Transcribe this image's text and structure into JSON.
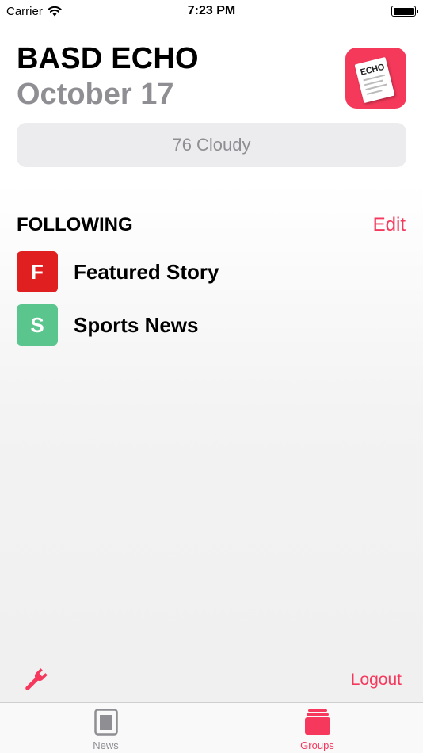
{
  "status_bar": {
    "carrier": "Carrier",
    "time": "7:23 PM"
  },
  "header": {
    "title": "BASD ECHO",
    "date": "October 17",
    "logo_text": "ECHO"
  },
  "weather": {
    "text": "76 Cloudy"
  },
  "following": {
    "heading": "FOLLOWING",
    "edit_label": "Edit",
    "items": [
      {
        "letter": "F",
        "label": "Featured Story",
        "color": "#e02020"
      },
      {
        "letter": "S",
        "label": "Sports News",
        "color": "#5ac58c"
      }
    ]
  },
  "footer": {
    "logout_label": "Logout",
    "settings_icon": "wrench-icon"
  },
  "tab_bar": {
    "tabs": [
      {
        "label": "News",
        "icon": "newspaper-icon",
        "selected": false
      },
      {
        "label": "Groups",
        "icon": "stack-icon",
        "selected": true
      }
    ]
  },
  "colors": {
    "accent": "#f5385c",
    "secondary_text": "#8e8e93",
    "inactive_tab": "#8e8e93"
  }
}
